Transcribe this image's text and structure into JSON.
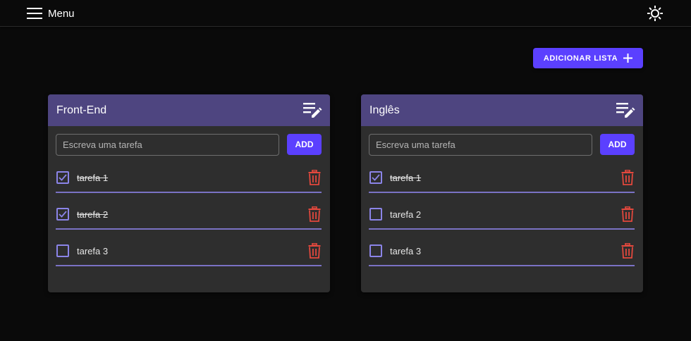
{
  "app": {
    "menu_label": "Menu",
    "add_list_label": "ADICIONAR LISTA"
  },
  "colors": {
    "accent": "#5b40ff",
    "card_header": "#4e4580",
    "checkbox": "#8b84e8",
    "delete": "#e3483d",
    "background": "#0a0a0a",
    "card": "#2e2e2e"
  },
  "lists": [
    {
      "title": "Front-End",
      "input_placeholder": "Escreva uma tarefa",
      "add_label": "ADD",
      "tasks": [
        {
          "text": "tarefa 1",
          "done": true
        },
        {
          "text": "tarefa 2",
          "done": true
        },
        {
          "text": "tarefa 3",
          "done": false
        }
      ]
    },
    {
      "title": "Inglês",
      "input_placeholder": "Escreva uma tarefa",
      "add_label": "ADD",
      "tasks": [
        {
          "text": "tarefa 1",
          "done": true
        },
        {
          "text": "tarefa 2",
          "done": false
        },
        {
          "text": "tarefa 3",
          "done": false
        }
      ]
    }
  ],
  "icons": {
    "menu": "hamburger-icon",
    "theme": "sun-icon",
    "add_list": "plus-icon",
    "edit": "playlist-edit-icon",
    "check": "check-icon",
    "delete": "trash-icon"
  }
}
